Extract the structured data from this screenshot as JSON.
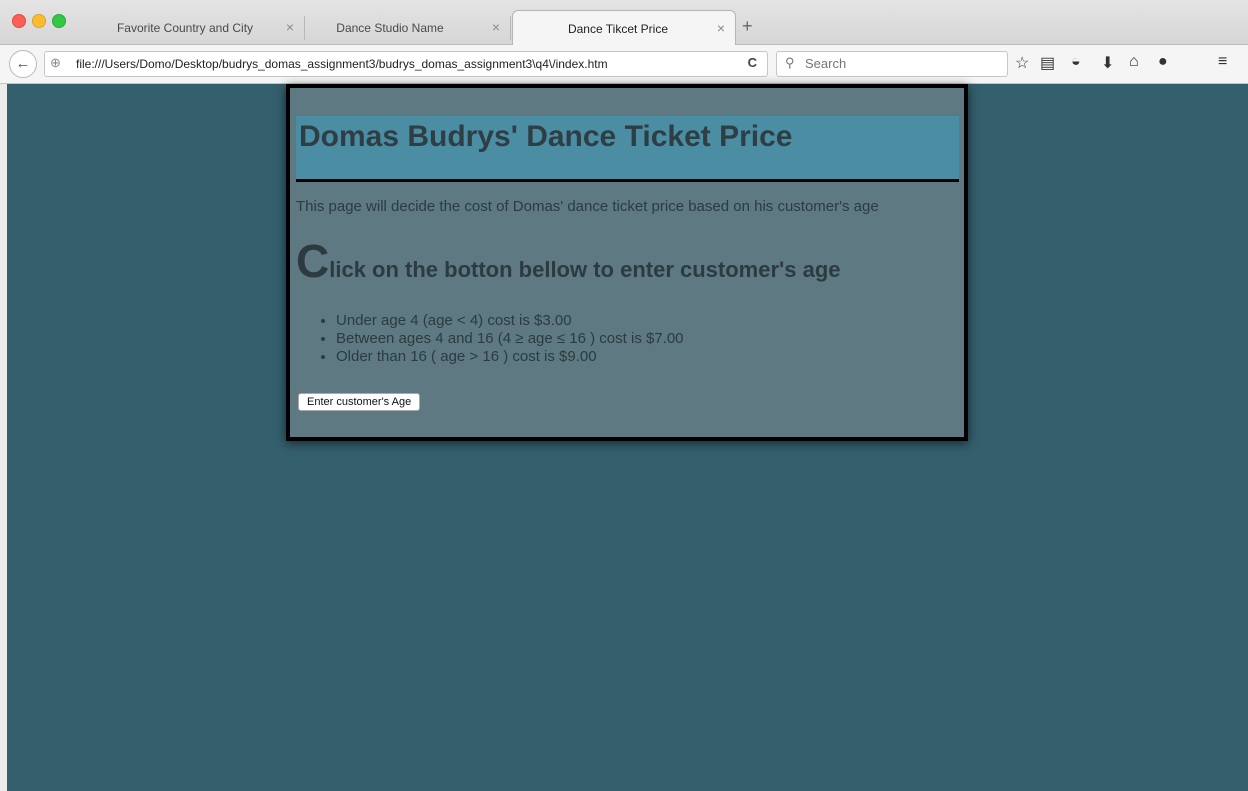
{
  "tabs": [
    {
      "title": "Favorite Country and City",
      "close": "×"
    },
    {
      "title": "Dance Studio Name",
      "close": "×"
    },
    {
      "title": "Dance Tikcet Price",
      "close": "×"
    }
  ],
  "new_tab": "+",
  "nav": {
    "back": "←",
    "url": "file:///Users/Domo/Desktop/budrys_domas_assignment3/budrys_domas_assignment3\\q4\\/index.htm",
    "reload": "C",
    "search_placeholder": "Search"
  },
  "toolbar_icons": [
    "star-icon",
    "reading-list-icon",
    "pocket-icon",
    "download-icon",
    "home-icon",
    "chat-icon",
    "menu-icon"
  ],
  "page": {
    "heading": "Domas Budrys' Dance Ticket Price",
    "description": "This page will decide the cost of Domas' dance ticket price based on his customer's age",
    "instruction_initial": "C",
    "instruction_rest": "lick on the botton bellow to enter customer's age",
    "prices": [
      "Under age 4 (age < 4) cost is $3.00",
      "Between ages 4 and 16 (4 ≥ age ≤ 16 ) cost is $7.00",
      "Older than 16 ( age > 16 ) cost is $9.00"
    ],
    "button_label": "Enter customer's Age"
  },
  "colors": {
    "background": "#345f6d",
    "card": "#5e7981",
    "banner": "#4b8ea3",
    "text": "#2b3b41"
  }
}
